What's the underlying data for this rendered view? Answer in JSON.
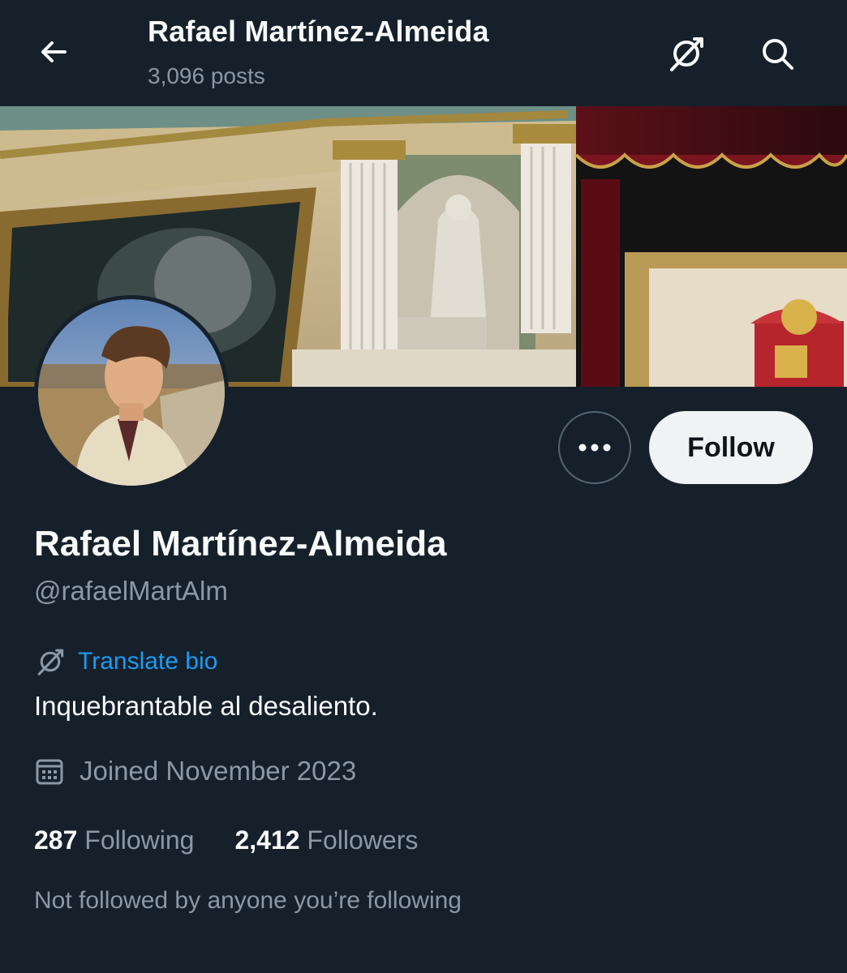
{
  "header": {
    "title": "Rafael Martínez-Almeida",
    "post_count": "3,096 posts",
    "back_icon": "arrow-left-icon",
    "translate_icon": "translate-off-icon",
    "search_icon": "search-icon"
  },
  "profile": {
    "display_name": "Rafael Martínez-Almeida",
    "handle": "@rafaelMartAlm",
    "translate_label": "Translate bio",
    "bio": "Inquebrantable al desaliento.",
    "joined": "Joined November 2023",
    "following_count": "287",
    "following_label": "Following",
    "followers_count": "2,412",
    "followers_label": "Followers",
    "mutuals_note": "Not followed by anyone you’re following"
  },
  "actions": {
    "follow_label": "Follow",
    "more_icon": "more-horizontal-icon"
  },
  "colors": {
    "background": "#15202b",
    "accent": "#1d9bf0",
    "muted": "#8b98a5",
    "button_bg": "#eff3f4"
  }
}
